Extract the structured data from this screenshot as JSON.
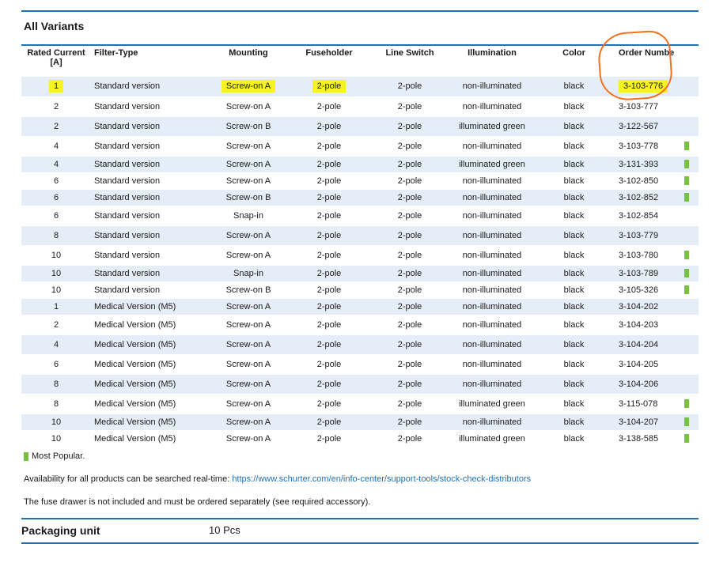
{
  "section_title": "All Variants",
  "table": {
    "headers": {
      "rated_current": "Rated Current\n[A]",
      "filter_type": "Filter-Type",
      "mounting": "Mounting",
      "fuseholder": "Fuseholder",
      "line_switch": "Line Switch",
      "illumination": "Illumination",
      "color": "Color",
      "order_number": "Order Numbe"
    },
    "rows": [
      {
        "current": "1",
        "filter": "Standard version",
        "mounting": "Screw-on A",
        "fuseholder": "2-pole",
        "switch": "2-pole",
        "illum": "non-illuminated",
        "color": "black",
        "order": "3-103-776",
        "popular": false,
        "highlight": true
      },
      {
        "current": "2",
        "filter": "Standard version",
        "mounting": "Screw-on A",
        "fuseholder": "2-pole",
        "switch": "2-pole",
        "illum": "non-illuminated",
        "color": "black",
        "order": "3-103-777",
        "popular": false
      },
      {
        "current": "2",
        "filter": "Standard version",
        "mounting": "Screw-on B",
        "fuseholder": "2-pole",
        "switch": "2-pole",
        "illum": "illuminated green",
        "color": "black",
        "order": "3-122-567",
        "popular": false
      },
      {
        "current": "4",
        "filter": "Standard version",
        "mounting": "Screw-on A",
        "fuseholder": "2-pole",
        "switch": "2-pole",
        "illum": "non-illuminated",
        "color": "black",
        "order": "3-103-778",
        "popular": true
      },
      {
        "current": "4",
        "filter": "Standard version",
        "mounting": "Screw-on A",
        "fuseholder": "2-pole",
        "switch": "2-pole",
        "illum": "illuminated green",
        "color": "black",
        "order": "3-131-393",
        "popular": true
      },
      {
        "current": "6",
        "filter": "Standard version",
        "mounting": "Screw-on A",
        "fuseholder": "2-pole",
        "switch": "2-pole",
        "illum": "non-illuminated",
        "color": "black",
        "order": "3-102-850",
        "popular": true
      },
      {
        "current": "6",
        "filter": "Standard version",
        "mounting": "Screw-on B",
        "fuseholder": "2-pole",
        "switch": "2-pole",
        "illum": "non-illuminated",
        "color": "black",
        "order": "3-102-852",
        "popular": true
      },
      {
        "current": "6",
        "filter": "Standard version",
        "mounting": "Snap-in",
        "fuseholder": "2-pole",
        "switch": "2-pole",
        "illum": "non-illuminated",
        "color": "black",
        "order": "3-102-854",
        "popular": false
      },
      {
        "current": "8",
        "filter": "Standard version",
        "mounting": "Screw-on A",
        "fuseholder": "2-pole",
        "switch": "2-pole",
        "illum": "non-illuminated",
        "color": "black",
        "order": "3-103-779",
        "popular": false
      },
      {
        "current": "10",
        "filter": "Standard version",
        "mounting": "Screw-on A",
        "fuseholder": "2-pole",
        "switch": "2-pole",
        "illum": "non-illuminated",
        "color": "black",
        "order": "3-103-780",
        "popular": true
      },
      {
        "current": "10",
        "filter": "Standard version",
        "mounting": "Snap-in",
        "fuseholder": "2-pole",
        "switch": "2-pole",
        "illum": "non-illuminated",
        "color": "black",
        "order": "3-103-789",
        "popular": true
      },
      {
        "current": "10",
        "filter": "Standard version",
        "mounting": "Screw-on B",
        "fuseholder": "2-pole",
        "switch": "2-pole",
        "illum": "non-illuminated",
        "color": "black",
        "order": "3-105-326",
        "popular": true
      },
      {
        "current": "1",
        "filter": "Medical Version (M5)",
        "mounting": "Screw-on A",
        "fuseholder": "2-pole",
        "switch": "2-pole",
        "illum": "non-illuminated",
        "color": "black",
        "order": "3-104-202",
        "popular": false
      },
      {
        "current": "2",
        "filter": "Medical Version (M5)",
        "mounting": "Screw-on A",
        "fuseholder": "2-pole",
        "switch": "2-pole",
        "illum": "non-illuminated",
        "color": "black",
        "order": "3-104-203",
        "popular": false
      },
      {
        "current": "4",
        "filter": "Medical Version (M5)",
        "mounting": "Screw-on A",
        "fuseholder": "2-pole",
        "switch": "2-pole",
        "illum": "non-illuminated",
        "color": "black",
        "order": "3-104-204",
        "popular": false
      },
      {
        "current": "6",
        "filter": "Medical Version (M5)",
        "mounting": "Screw-on A",
        "fuseholder": "2-pole",
        "switch": "2-pole",
        "illum": "non-illuminated",
        "color": "black",
        "order": "3-104-205",
        "popular": false
      },
      {
        "current": "8",
        "filter": "Medical Version (M5)",
        "mounting": "Screw-on A",
        "fuseholder": "2-pole",
        "switch": "2-pole",
        "illum": "non-illuminated",
        "color": "black",
        "order": "3-104-206",
        "popular": false
      },
      {
        "current": "8",
        "filter": "Medical Version (M5)",
        "mounting": "Screw-on A",
        "fuseholder": "2-pole",
        "switch": "2-pole",
        "illum": "illuminated green",
        "color": "black",
        "order": "3-115-078",
        "popular": true
      },
      {
        "current": "10",
        "filter": "Medical Version (M5)",
        "mounting": "Screw-on A",
        "fuseholder": "2-pole",
        "switch": "2-pole",
        "illum": "non-illuminated",
        "color": "black",
        "order": "3-104-207",
        "popular": true
      },
      {
        "current": "10",
        "filter": "Medical Version (M5)",
        "mounting": "Screw-on A",
        "fuseholder": "2-pole",
        "switch": "2-pole",
        "illum": "illuminated green",
        "color": "black",
        "order": "3-138-585",
        "popular": true
      }
    ]
  },
  "legend": {
    "label": "Most Popular.",
    "color": "#78c142"
  },
  "availability": {
    "text": "Availability for all products can be searched real-time: ",
    "link": "https://www.schurter.com/en/info-center/support-tools/stock-check-distributors"
  },
  "note": "The fuse drawer is not included and must be ordered separately (see required accessory).",
  "packaging": {
    "label": "Packaging unit",
    "value": "10 Pcs"
  },
  "colors": {
    "accent": "#1f72b8",
    "row_shade": "#e5eef7",
    "highlight": "#f7f323",
    "annotation": "#f36f21",
    "popular": "#78c142"
  }
}
